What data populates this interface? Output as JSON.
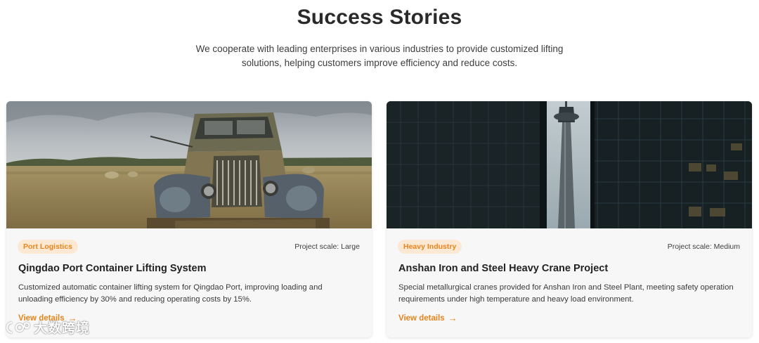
{
  "section": {
    "title": "Success Stories",
    "subtitle": "We cooperate with leading enterprises in various industries to provide customized lifting solutions, helping customers improve efficiency and reduce costs."
  },
  "cases": [
    {
      "image_icon": "vintage-truck-photo",
      "tag": "Port Logistics",
      "scale": "Project scale: Large",
      "title": "Qingdao Port Container Lifting System",
      "description": "Customized automatic container lifting system for Qingdao Port, improving loading and unloading efficiency by 30% and reducing operating costs by 15%.",
      "link_label": "View details"
    },
    {
      "image_icon": "city-tower-photo",
      "tag": "Heavy Industry",
      "scale": "Project scale: Medium",
      "title": "Anshan Iron and Steel Heavy Crane Project",
      "description": "Special metallurgical cranes provided for Anshan Iron and Steel Plant, meeting safety operation requirements under high temperature and heavy load environment.",
      "link_label": "View details"
    }
  ],
  "watermark": {
    "text": "大数跨境",
    "icon": "watermark-logo-icon"
  },
  "colors": {
    "accent": "#e8841c",
    "tag_background": "#fde9d3",
    "card_background": "#f7f7f7",
    "title": "#2a2a2a"
  }
}
